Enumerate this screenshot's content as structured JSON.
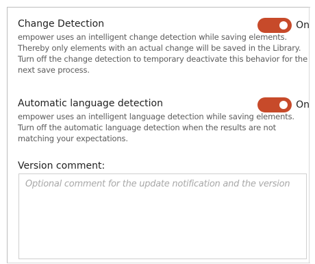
{
  "change_detection": {
    "title": "Change Detection",
    "toggle_label": "On",
    "toggle_state": "on",
    "description": "empower uses an intelligent change detection while saving elements. Thereby only elements with an actual change will be saved in the Library. Turn off the change detection to temporary deactivate this behavior for the next save process."
  },
  "language_detection": {
    "title": "Automatic language detection",
    "toggle_label": "On",
    "toggle_state": "on",
    "description": "empower uses an intelligent language detection while saving elements. Turn off the automatic language detection when the results are not matching your expectations."
  },
  "version_comment": {
    "label": "Version comment:",
    "placeholder": "Optional comment for the update notification and the version",
    "value": ""
  },
  "colors": {
    "toggle_on": "#c74a2a",
    "description_text": "#5a5a5a",
    "placeholder_text": "#a8a8a8"
  }
}
